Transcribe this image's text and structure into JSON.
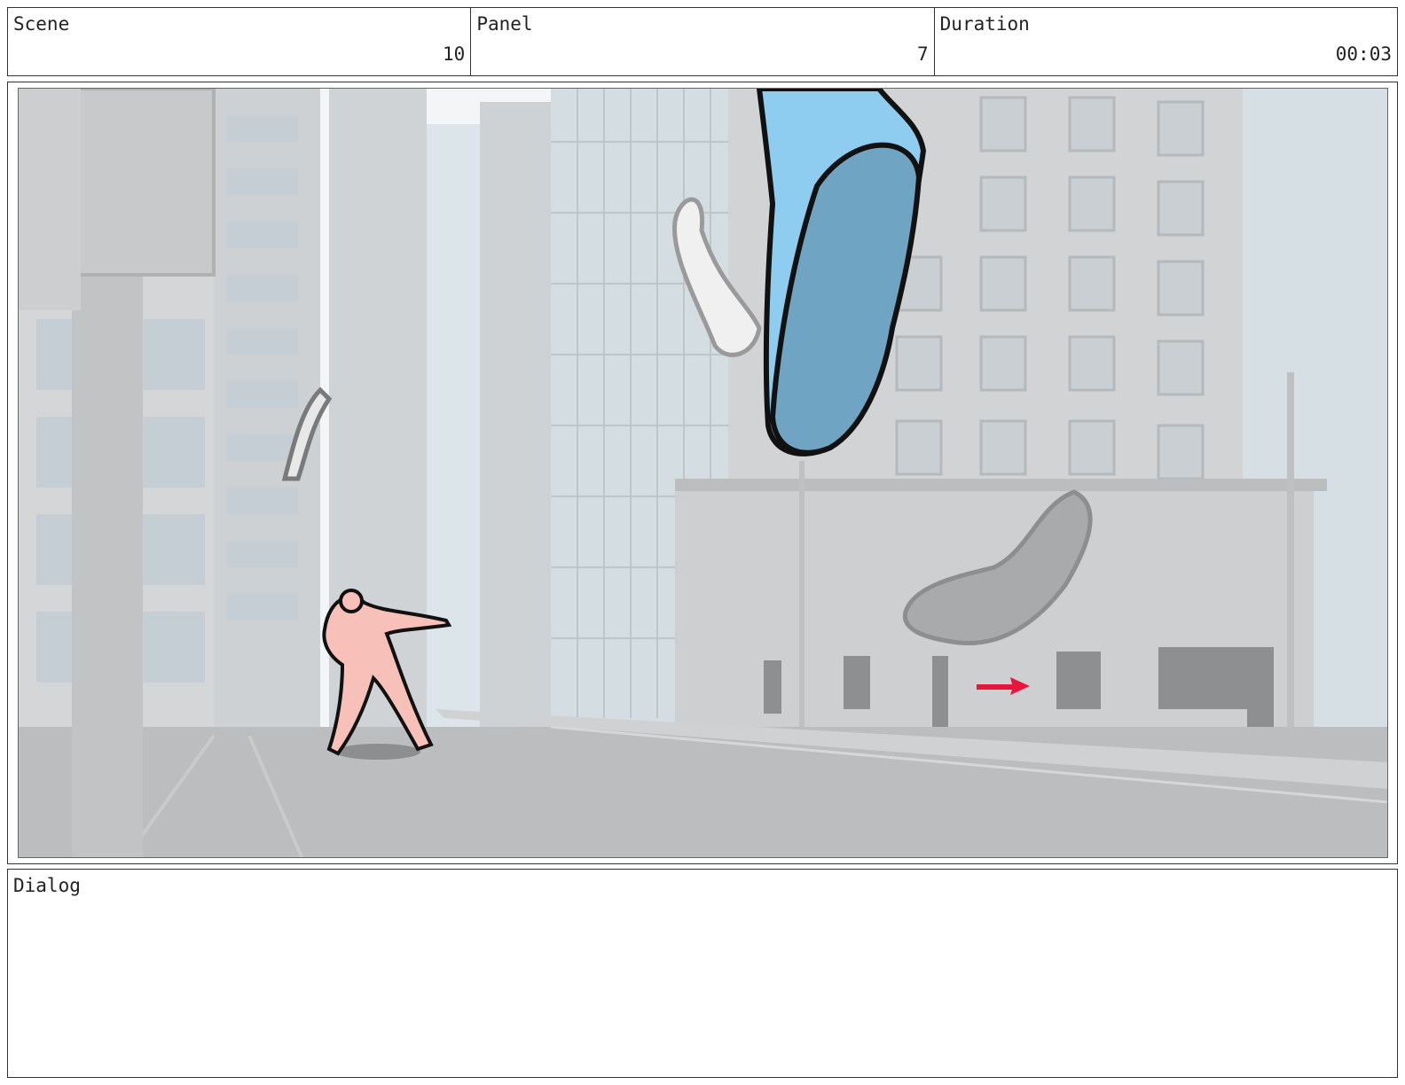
{
  "header": {
    "scene": {
      "label": "Scene",
      "value": "10"
    },
    "panel": {
      "label": "Panel",
      "value": "7"
    },
    "duration": {
      "label": "Duration",
      "value": "00:03"
    }
  },
  "dialog": {
    "label": "Dialog",
    "text": ""
  }
}
